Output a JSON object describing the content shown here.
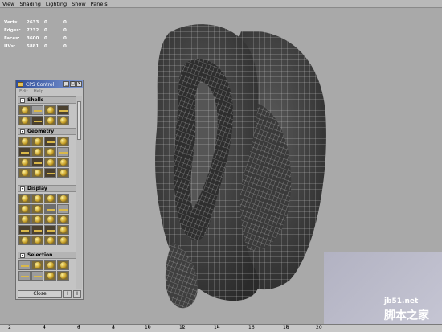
{
  "menu": [
    "View",
    "Shading",
    "Lighting",
    "Show",
    "Panels"
  ],
  "hud": [
    {
      "label": "Verts:",
      "value": "2633",
      "a": "0",
      "b": "0"
    },
    {
      "label": "Edges:",
      "value": "7232",
      "a": "0",
      "b": "0"
    },
    {
      "label": "Faces:",
      "value": "3600",
      "a": "0",
      "b": "0"
    },
    {
      "label": "UVs:",
      "value": "5881",
      "a": "0",
      "b": "0"
    }
  ],
  "camera": "persp",
  "panel": {
    "title": "CPS Control",
    "menu": [
      "Edit",
      "Help"
    ],
    "sections": [
      "Shells",
      "Geometry",
      "Display",
      "Selection"
    ],
    "close_label": "Close",
    "small_buttons": [
      "I",
      "I"
    ]
  },
  "timeline": {
    "ticks": [
      "2",
      "4",
      "6",
      "8",
      "10",
      "12",
      "14",
      "16",
      "18",
      "20"
    ]
  },
  "watermark": {
    "url": "jb51.net",
    "text": "脚本之家"
  }
}
